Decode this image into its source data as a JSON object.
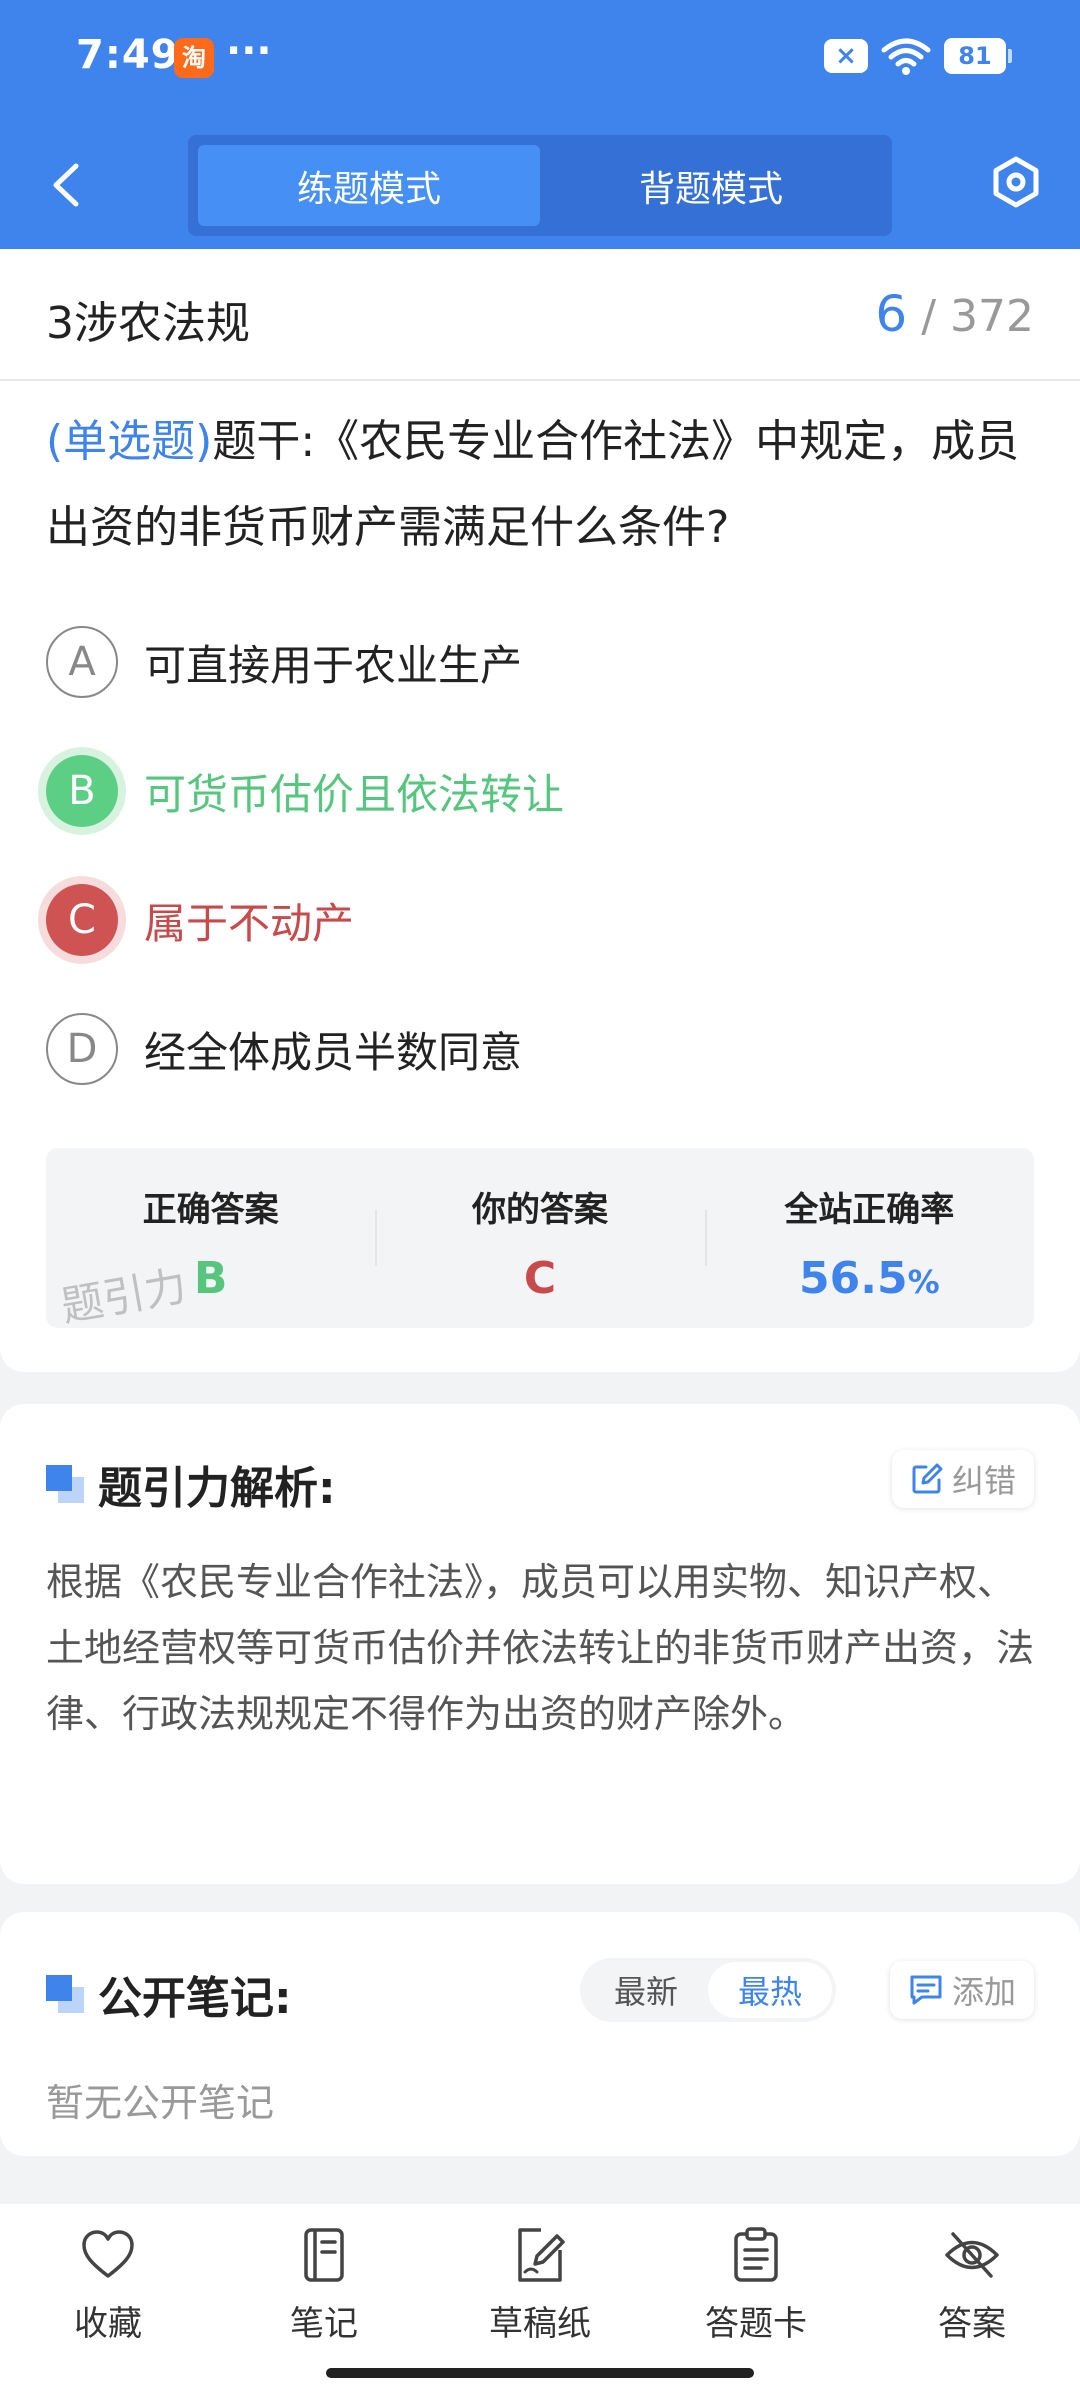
{
  "status_bar": {
    "time": "7:49",
    "app_badge": "淘",
    "dots": "···",
    "vpn_icon": "×",
    "battery": "81"
  },
  "header": {
    "tabs": [
      {
        "label": "练题模式",
        "active": true
      },
      {
        "label": "背题模式",
        "active": false
      }
    ]
  },
  "topic": {
    "name": "3涉农法规",
    "current": "6",
    "separator": " / ",
    "total": "372"
  },
  "question": {
    "type": "(单选题)",
    "stem": "题干:《农民专业合作社法》中规定，成员出资的非货币财产需满足什么条件?"
  },
  "options": [
    {
      "letter": "A",
      "text": "可直接用于农业生产",
      "state": "normal"
    },
    {
      "letter": "B",
      "text": "可货币估价且依法转让",
      "state": "correct"
    },
    {
      "letter": "C",
      "text": "属于不动产",
      "state": "wrong"
    },
    {
      "letter": "D",
      "text": "经全体成员半数同意",
      "state": "normal"
    }
  ],
  "answer_summary": {
    "correct_label": "正确答案",
    "correct_value": "B",
    "yours_label": "你的答案",
    "yours_value": "C",
    "rate_label": "全站正确率",
    "rate_value": "56.5",
    "rate_unit": "%",
    "watermark": "题引力"
  },
  "analysis": {
    "title": "题引力解析:",
    "report_label": "纠错",
    "text": "根据《农民专业合作社法》，成员可以用实物、知识产权、土地经营权等可货币估价并依法转让的非货币财产出资，法律、行政法规规定不得作为出资的财产除外。"
  },
  "notes": {
    "title": "公开笔记:",
    "sort_options": [
      {
        "label": "最新",
        "active": false
      },
      {
        "label": "最热",
        "active": true
      }
    ],
    "add_label": "添加",
    "empty_text": "暂无公开笔记"
  },
  "bottom_nav": [
    {
      "label": "收藏",
      "icon": "heart-icon"
    },
    {
      "label": "笔记",
      "icon": "notebook-icon"
    },
    {
      "label": "草稿纸",
      "icon": "draft-icon"
    },
    {
      "label": "答题卡",
      "icon": "answer-card-icon"
    },
    {
      "label": "答案",
      "icon": "eye-off-icon"
    }
  ],
  "colors": {
    "primary": "#3f84ec",
    "correct": "#56c67f",
    "wrong": "#c74b4b"
  }
}
